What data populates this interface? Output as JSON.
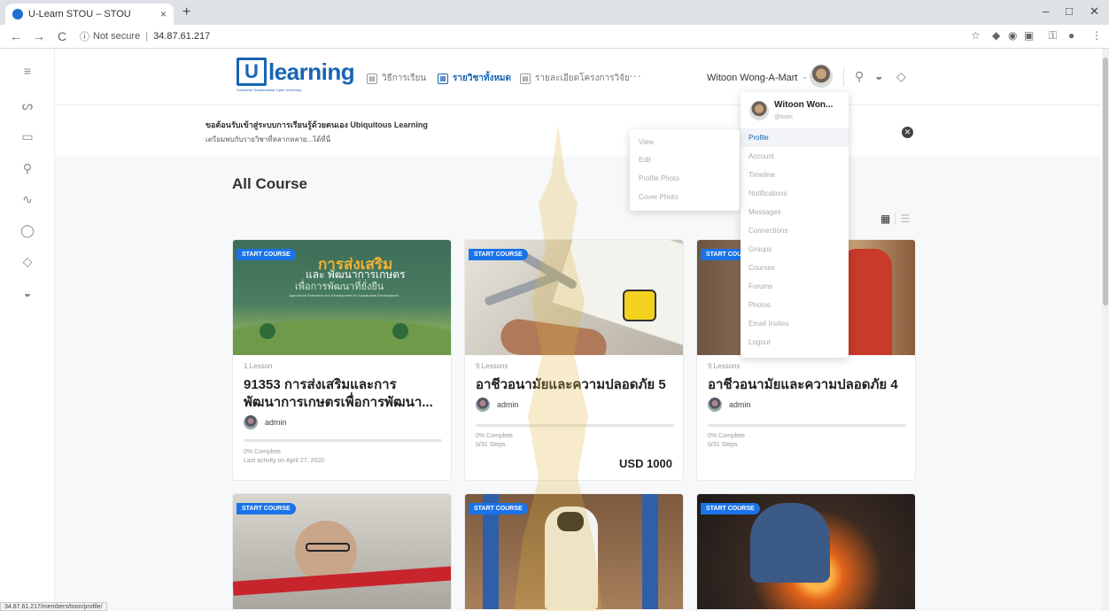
{
  "browser": {
    "tab_title": "U-Learn STOU – STOU",
    "tab_close": "×",
    "new_tab": "+",
    "nav_back": "←",
    "nav_forward": "→",
    "nav_reload": "C",
    "security": "Not secure",
    "security_icon": "ⓘ",
    "url": "34.87.61.217",
    "window_minimize": "–",
    "window_maximize": "□",
    "window_close": "✕",
    "status_url": "34.87.61.217/members/toon/profile/"
  },
  "header": {
    "logo_letter": "U",
    "logo_word": "learning",
    "logo_tagline": "Sukhothai Thammathirat Open University",
    "nav": [
      {
        "label": "วิธีการเรียน",
        "icon": "▤"
      },
      {
        "label": "รายวิชาทั้งหมด",
        "icon": "▦"
      },
      {
        "label": "รายละเอียดโครงการวิจัย",
        "icon": "▤"
      }
    ],
    "more": "···",
    "username": "Witoon Wong-A-Mart",
    "chevron": "⌄"
  },
  "welcome": {
    "line1": "ขอต้อนรับเข้าสู่ระบบการเรียนรู้ด้วยตนเอง Ubiquitous Learning",
    "line2": "เตรียมพบกับรายวิชาที่หลากหลาย...ได้ที่นี่",
    "close": "✕"
  },
  "page_title": "All Course",
  "courses": [
    {
      "badge": "START COURSE",
      "lessons": "1 Lesson",
      "title": "91353 การส่งเสริมและการพัฒนาการเกษตรเพื่อการพัฒนา...",
      "author": "admin",
      "complete": "0% Complete",
      "extra": "Last activity on April 27, 2020",
      "price": "",
      "progress": 0,
      "thumb_title1": "การส่งเสริม",
      "thumb_title2": "และ พัฒนาการเกษตร",
      "thumb_title3": "เพื่อการพัฒนาที่ยั่งยืน",
      "thumb_sub": "Agricultural Extension and Development for Sustainable Development"
    },
    {
      "badge": "START COURSE",
      "lessons": "9 Lessons",
      "title": "อาชีวอนามัยและความปลอดภัย 5",
      "author": "admin",
      "complete": "0% Complete",
      "extra": "0/31 Steps",
      "price": "USD 1000",
      "progress": 0
    },
    {
      "badge": "START COURSE",
      "lessons": "9 Lessons",
      "title": "อาชีวอนามัยและความปลอดภัย 4",
      "author": "admin",
      "complete": "0% Complete",
      "extra": "0/31 Steps",
      "price": "",
      "progress": 0
    },
    {
      "badge": "START COURSE"
    },
    {
      "badge": "START COURSE"
    },
    {
      "badge": "START COURSE"
    }
  ],
  "user_menu": {
    "name": "Witoon Won...",
    "handle": "@toon",
    "items": [
      "Profile",
      "Account",
      "Timeline",
      "Notifications",
      "Messages",
      "Connections",
      "Groups",
      "Courses",
      "Forums",
      "Photos",
      "Email Invites",
      "Logout"
    ]
  },
  "profile_submenu": [
    "View",
    "Edit",
    "Profile Photo",
    "Cover Photo"
  ],
  "colors": {
    "brand": "#1764b5",
    "badge": "#1a73e8"
  }
}
